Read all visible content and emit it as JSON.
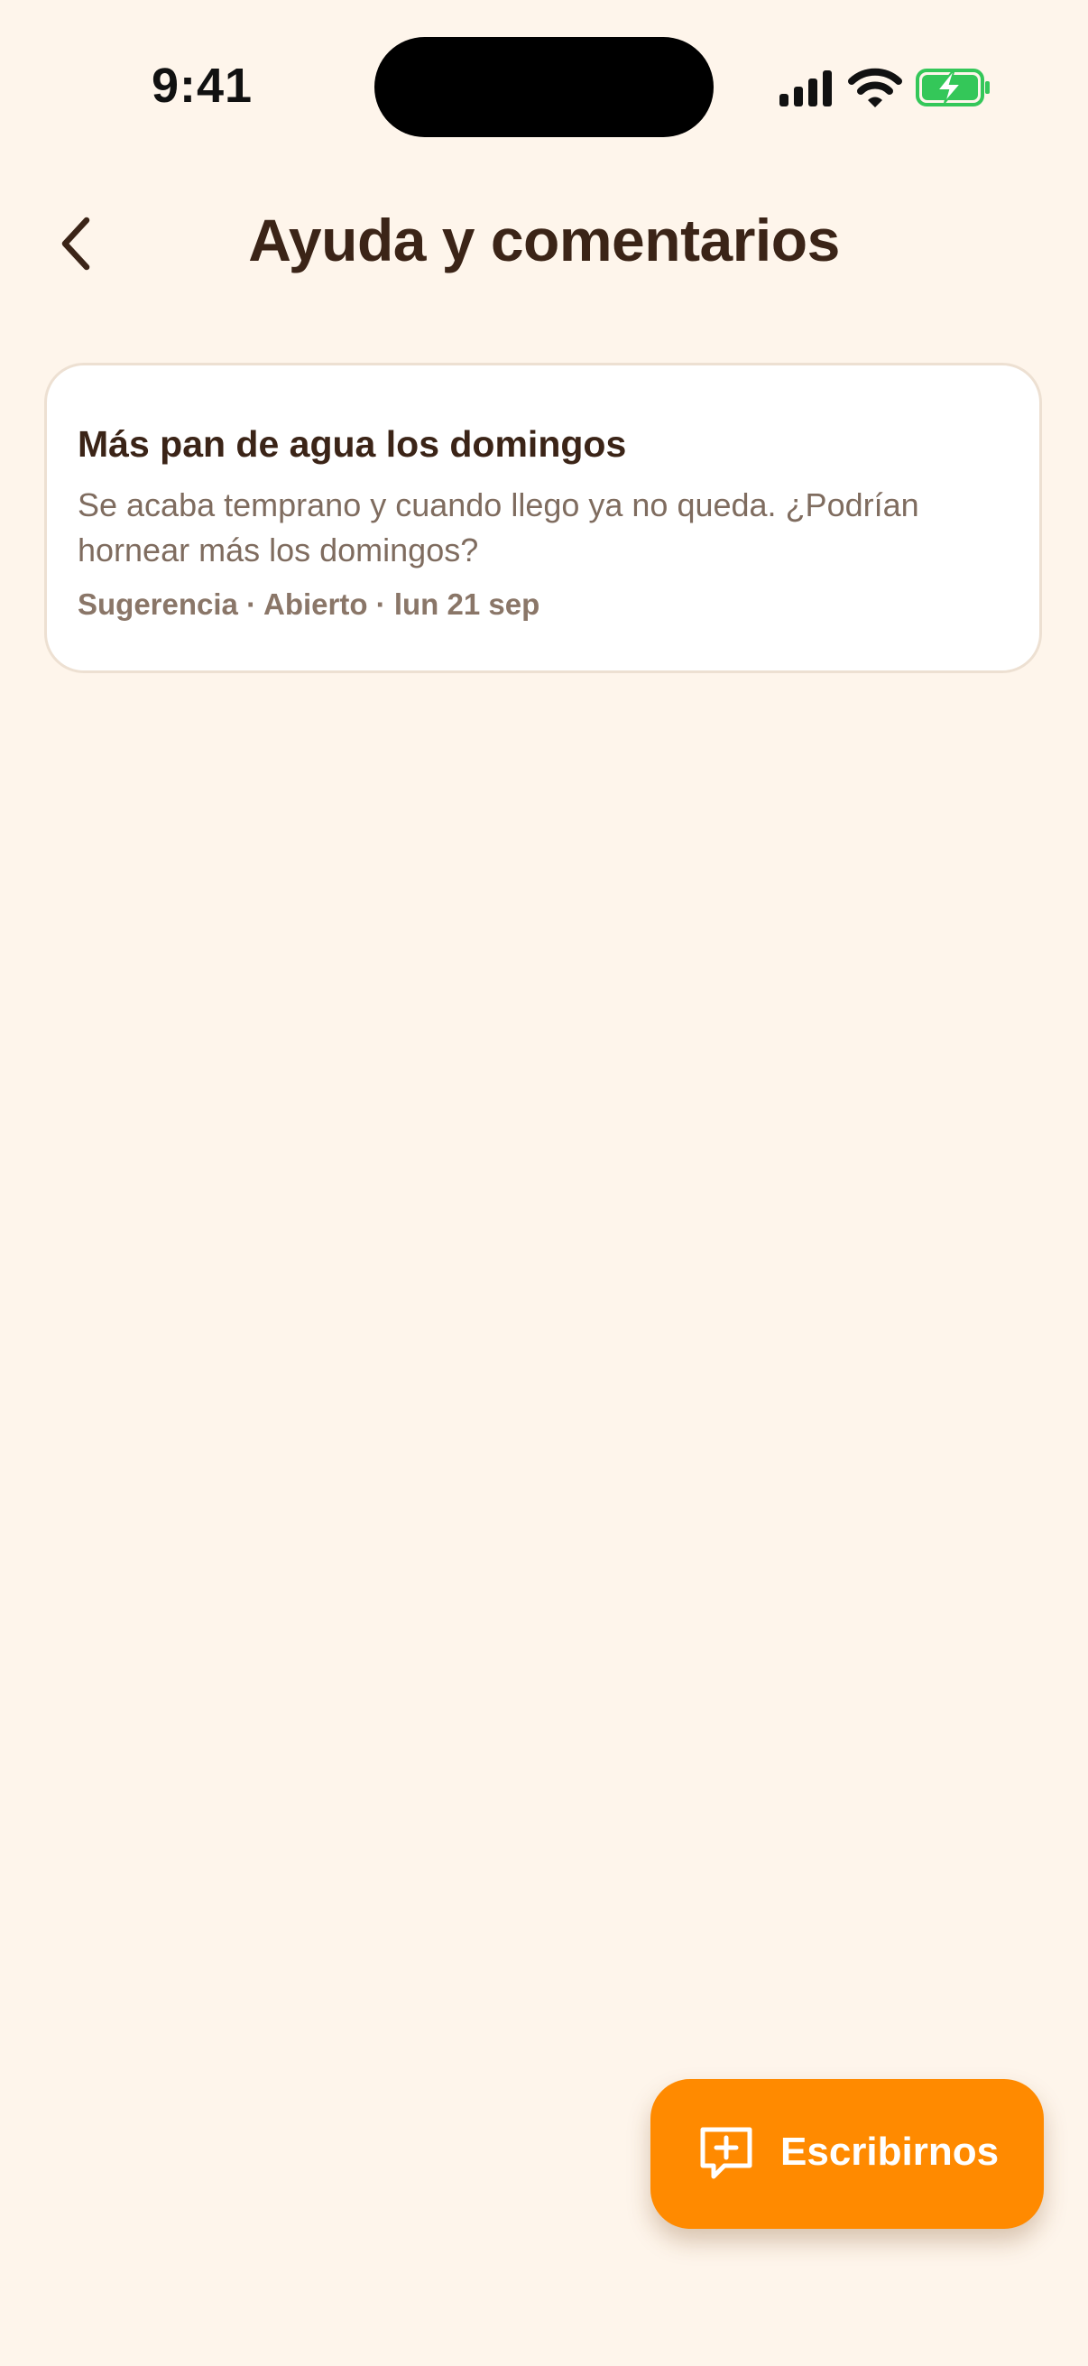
{
  "status_bar": {
    "time": "9:41",
    "icons": [
      "signal-icon",
      "wifi-icon",
      "battery-charging-icon"
    ],
    "battery_color": "#34C759"
  },
  "header": {
    "title": "Ayuda y comentarios",
    "back_icon": "chevron-left-icon"
  },
  "tickets": [
    {
      "title": "Más pan de agua los domingos",
      "body": "Se acaba temprano y cuando llego ya no queda. ¿Podrían hornear más los domingos?",
      "meta": "Sugerencia · Abierto · lun 21 sep"
    }
  ],
  "fab": {
    "label": "Escribirnos",
    "icon": "message-plus-icon",
    "color": "#FF8A00"
  },
  "colors": {
    "background": "#FEF5EB",
    "text_primary": "#3B2417",
    "text_secondary": "#7F6C5F",
    "card_border": "#EDE0D2"
  }
}
